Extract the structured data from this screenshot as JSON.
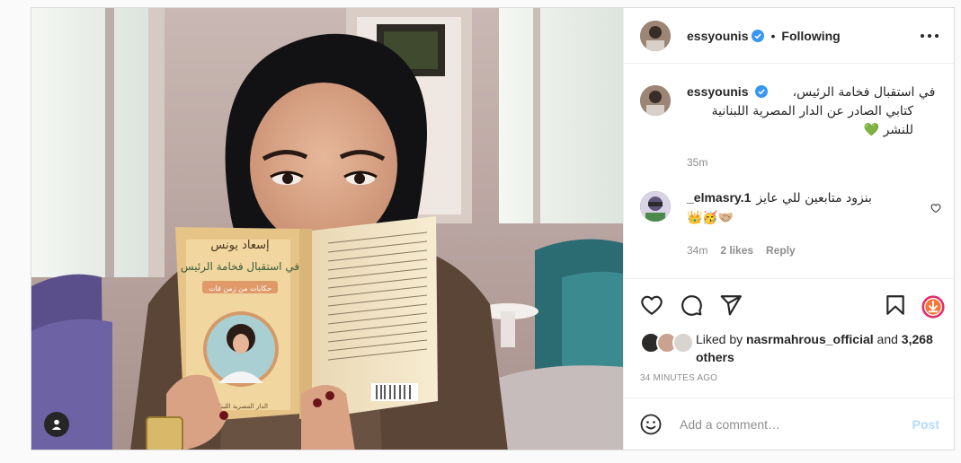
{
  "post": {
    "username": "essyounis",
    "follow_status": "Following",
    "dot": "•",
    "caption": {
      "username": "essyounis",
      "line1": "في استقبال فخامة الرئيس،",
      "line2": "كتابي الصادر عن الدار المصرية اللبنانية",
      "line3": "للنشر",
      "emoji": "💚",
      "time": "35m"
    },
    "comments": [
      {
        "username": "_elmasry.1",
        "text": "بنزود متابعين للي عايز",
        "emojis": "👑🥳🤝🏼",
        "time": "34m",
        "likes": "2 likes",
        "reply": "Reply"
      }
    ],
    "likes": {
      "prefix": "Liked by",
      "user": "nasrmahrous_official",
      "and": "and",
      "others": "3,268 others"
    },
    "timestamp": "34 MINUTES AGO",
    "add_comment": {
      "placeholder": "Add a comment…",
      "emoji_icon": "smiley-icon",
      "post_label": "Post"
    }
  },
  "book": {
    "author": "إسعاد يونس",
    "title": "في استقبال فخامة الرئيس",
    "subtitle": "حكايات من زمن فات",
    "spine": "إسعاد يونس   في استقبال فخامة الرئيس",
    "publisher": "الدار المصرية اللبنانية"
  },
  "colors": {
    "accent": "#0095f6",
    "verified": "#3897f0",
    "post_disabled": "#b3dbff",
    "save_ring": "#e1306c"
  }
}
